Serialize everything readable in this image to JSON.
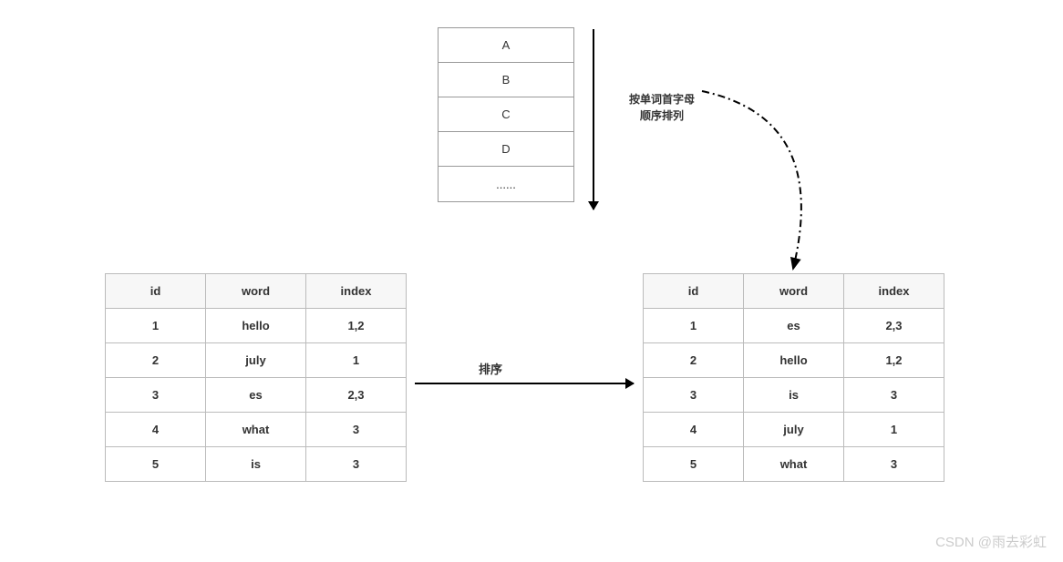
{
  "alpha_list": [
    "A",
    "B",
    "C",
    "D",
    "......"
  ],
  "label_alpha_line1": "按单词首字母",
  "label_alpha_line2": "顺序排列",
  "label_sort": "排序",
  "headers": {
    "id": "id",
    "word": "word",
    "index": "index"
  },
  "table_left": [
    {
      "id": "1",
      "word": "hello",
      "index": "1,2"
    },
    {
      "id": "2",
      "word": "july",
      "index": "1"
    },
    {
      "id": "3",
      "word": "es",
      "index": "2,3"
    },
    {
      "id": "4",
      "word": "what",
      "index": "3"
    },
    {
      "id": "5",
      "word": "is",
      "index": "3"
    }
  ],
  "table_right": [
    {
      "id": "1",
      "word": "es",
      "index": "2,3"
    },
    {
      "id": "2",
      "word": "hello",
      "index": "1,2"
    },
    {
      "id": "3",
      "word": "is",
      "index": "3"
    },
    {
      "id": "4",
      "word": "july",
      "index": "1"
    },
    {
      "id": "5",
      "word": "what",
      "index": "3"
    }
  ],
  "watermark": "CSDN @雨去彩虹"
}
